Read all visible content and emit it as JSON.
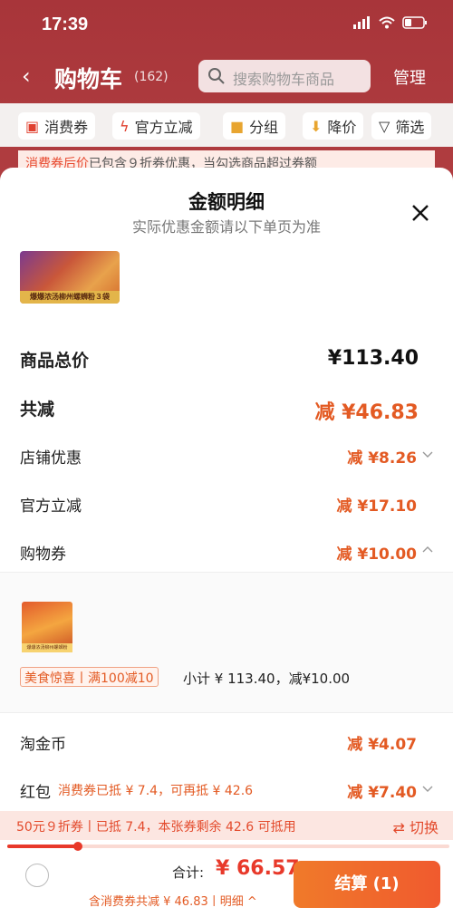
{
  "status_bar": {
    "time": "17:39"
  },
  "nav": {
    "back": "‹",
    "title": "购物车",
    "count": "(162)",
    "search_placeholder": "搜索购物车商品",
    "manage": "管理"
  },
  "filters": [
    {
      "icon": "coupon-icon",
      "label": "消费券"
    },
    {
      "icon": "lightning-icon",
      "label": "官方立减"
    },
    {
      "icon": "folder-icon",
      "label": "分组"
    },
    {
      "icon": "price-down-icon",
      "label": "降价"
    },
    {
      "icon": "filter-icon",
      "label": "筛选"
    }
  ],
  "notice": {
    "highlight": "消费券后价",
    "text": "已包含９折券优惠，当勾选商品超过券额"
  },
  "sheet": {
    "title": "金额明细",
    "subtitle": "实际优惠金额请以下单页为准",
    "product1_caption": "爆爆浓汤柳州螺蛳粉３袋",
    "rows": [
      {
        "label": "商品总价",
        "value": "¥113.40"
      },
      {
        "label": "共减",
        "value": "减 ¥46.83"
      },
      {
        "label": "店铺优惠",
        "value": "减 ¥8.26"
      },
      {
        "label": "官方立减",
        "value": "减 ¥17.10"
      },
      {
        "label": "购物券",
        "value": "减 ¥10.00"
      }
    ],
    "coupon_detail": {
      "product_caption": "爆爆浓汤柳州螺蛳粉",
      "tag": "美食惊喜丨满100减10",
      "subtotal": "小计 ¥ 113.40，减¥10.00"
    },
    "rows2": [
      {
        "label": "淘金币",
        "value": "减 ¥4.07"
      },
      {
        "label": "红包",
        "sub": "消费券已抵 ¥ 7.4，可再抵 ¥ 42.6",
        "value": "减 ¥7.40"
      }
    ],
    "banner": {
      "text": "50元９折券丨已抵 7.4，本张券剩余 42.6 可抵用",
      "switch": "⇄ 切换",
      "progress": 0.16
    }
  },
  "bottom": {
    "sum_label": "合计:",
    "sum_value": "¥ 66.57",
    "note": "含消费券共减 ¥ 46.83丨明细 ^",
    "checkout": "结算 (1)"
  },
  "colors": {
    "accent": "#e35a23",
    "header": "#a8353a",
    "checkout": "#f05a2e"
  }
}
